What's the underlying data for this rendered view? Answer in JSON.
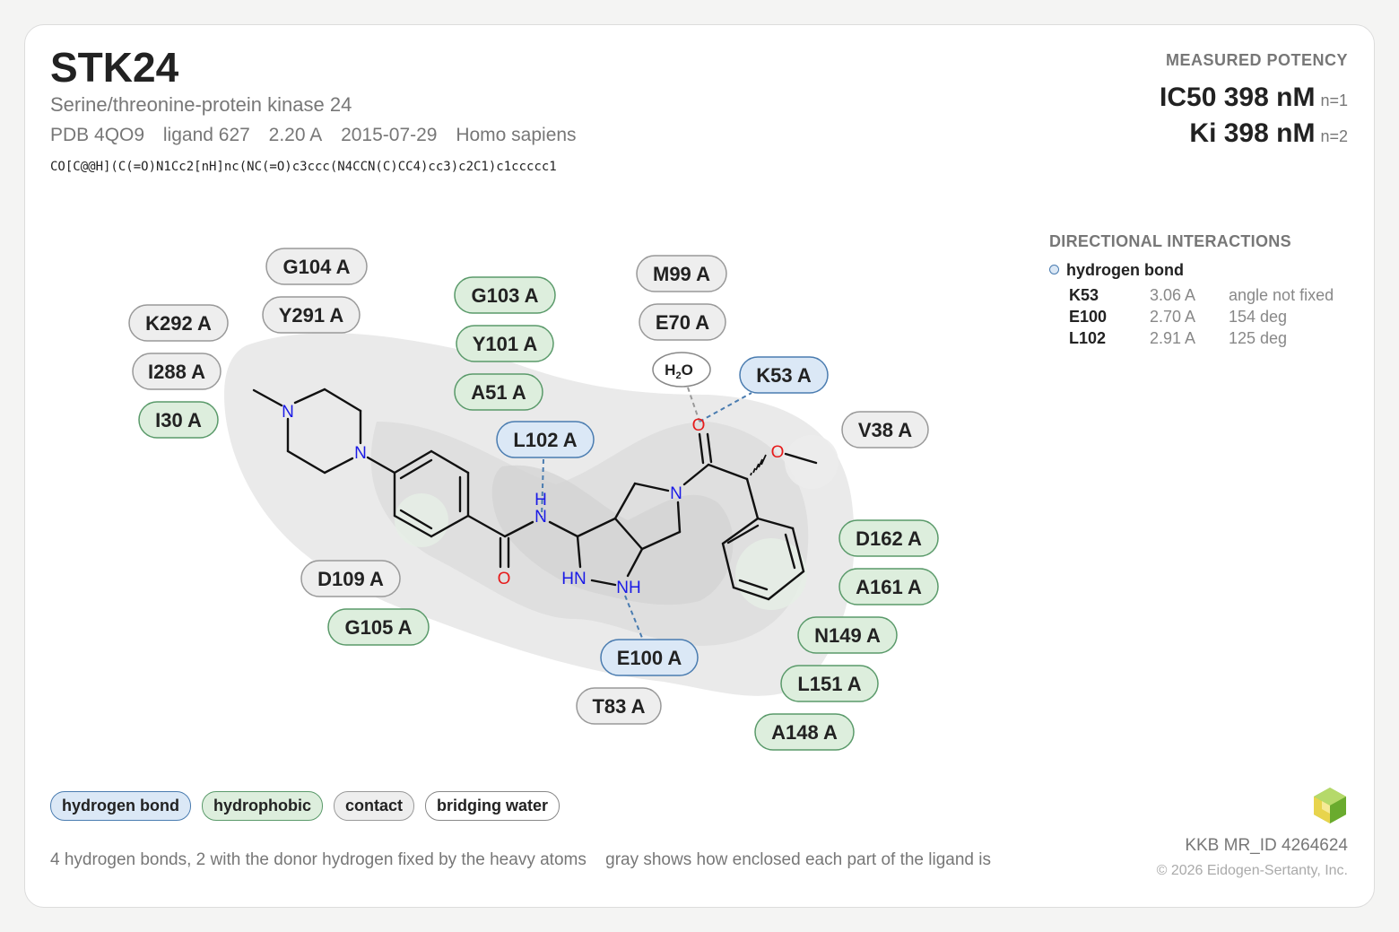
{
  "header": {
    "title": "STK24",
    "subtitle": "Serine/threonine-protein kinase 24",
    "pdb": "PDB 4QO9",
    "ligand": "ligand 627",
    "resolution": "2.20 A",
    "date": "2015-07-29",
    "organism": "Homo sapiens",
    "smiles": "CO[C@@H](C(=O)N1Cc2[nH]nc(NC(=O)c3ccc(N4CCN(C)CC4)cc3)c2C1)c1ccccc1"
  },
  "potency": {
    "heading": "MEASURED POTENCY",
    "rows": [
      {
        "label": "IC50 398 nM",
        "n": "n=1"
      },
      {
        "label": "Ki 398 nM",
        "n": "n=2"
      }
    ]
  },
  "interactions": {
    "heading": "DIRECTIONAL INTERACTIONS",
    "type": "hydrogen bond",
    "rows": [
      {
        "res": "K53",
        "dist": "3.06 A",
        "angle": "angle not fixed"
      },
      {
        "res": "E100",
        "dist": "2.70 A",
        "angle": "154 deg"
      },
      {
        "res": "L102",
        "dist": "2.91 A",
        "angle": "125 deg"
      }
    ]
  },
  "residues": [
    {
      "label": "G104 A",
      "kind": "contact"
    },
    {
      "label": "Y291 A",
      "kind": "contact"
    },
    {
      "label": "K292 A",
      "kind": "contact"
    },
    {
      "label": "I288 A",
      "kind": "contact"
    },
    {
      "label": "I30 A",
      "kind": "hydrophobic"
    },
    {
      "label": "G103 A",
      "kind": "hydrophobic"
    },
    {
      "label": "Y101 A",
      "kind": "hydrophobic"
    },
    {
      "label": "A51 A",
      "kind": "hydrophobic"
    },
    {
      "label": "L102 A",
      "kind": "hbond"
    },
    {
      "label": "M99 A",
      "kind": "contact"
    },
    {
      "label": "E70 A",
      "kind": "contact"
    },
    {
      "label": "K53 A",
      "kind": "hbond"
    },
    {
      "label": "V38 A",
      "kind": "contact"
    },
    {
      "label": "D162 A",
      "kind": "hydrophobic"
    },
    {
      "label": "A161 A",
      "kind": "hydrophobic"
    },
    {
      "label": "N149 A",
      "kind": "hydrophobic"
    },
    {
      "label": "L151 A",
      "kind": "hydrophobic"
    },
    {
      "label": "A148 A",
      "kind": "hydrophobic"
    },
    {
      "label": "D109 A",
      "kind": "contact"
    },
    {
      "label": "G105 A",
      "kind": "hydrophobic"
    },
    {
      "label": "E100 A",
      "kind": "hbond"
    },
    {
      "label": "T83 A",
      "kind": "contact"
    }
  ],
  "atom_labels": {
    "n_methyl": "N",
    "n_aryl": "N",
    "o_amide": "O",
    "n_amide_h": "H",
    "n_amide": "N",
    "hn_pyrazole": "HN",
    "nh_pyrazole": "NH",
    "n_pyrrolidine": "N",
    "o_carbonyl": "O",
    "o_methoxy": "O",
    "water_h": "H",
    "water_sub": "2",
    "water_o": "O"
  },
  "legend": {
    "hbond": "hydrogen bond",
    "hydrophobic": "hydrophobic",
    "contact": "contact",
    "water": "bridging water"
  },
  "footer": {
    "note1": "4 hydrogen bonds, 2 with the donor hydrogen fixed by the heavy atoms",
    "note2": "gray shows how enclosed each part of the ligand is",
    "mr_id": "KKB MR_ID 4264624",
    "copyright": "© 2026 Eidogen-Sertanty, Inc."
  },
  "colors": {
    "hbond_fill": "#dbe8f6",
    "hbond_stroke": "#4a7cb0",
    "hydrophobic_fill": "#ddeedd",
    "hydrophobic_stroke": "#5a9a6a",
    "contact_fill": "#eeeeee",
    "contact_stroke": "#999999",
    "nitrogen": "#1a1ae6",
    "oxygen": "#e61a1a",
    "logo_green": "#8dc63f",
    "logo_yellow": "#e8d44d"
  }
}
